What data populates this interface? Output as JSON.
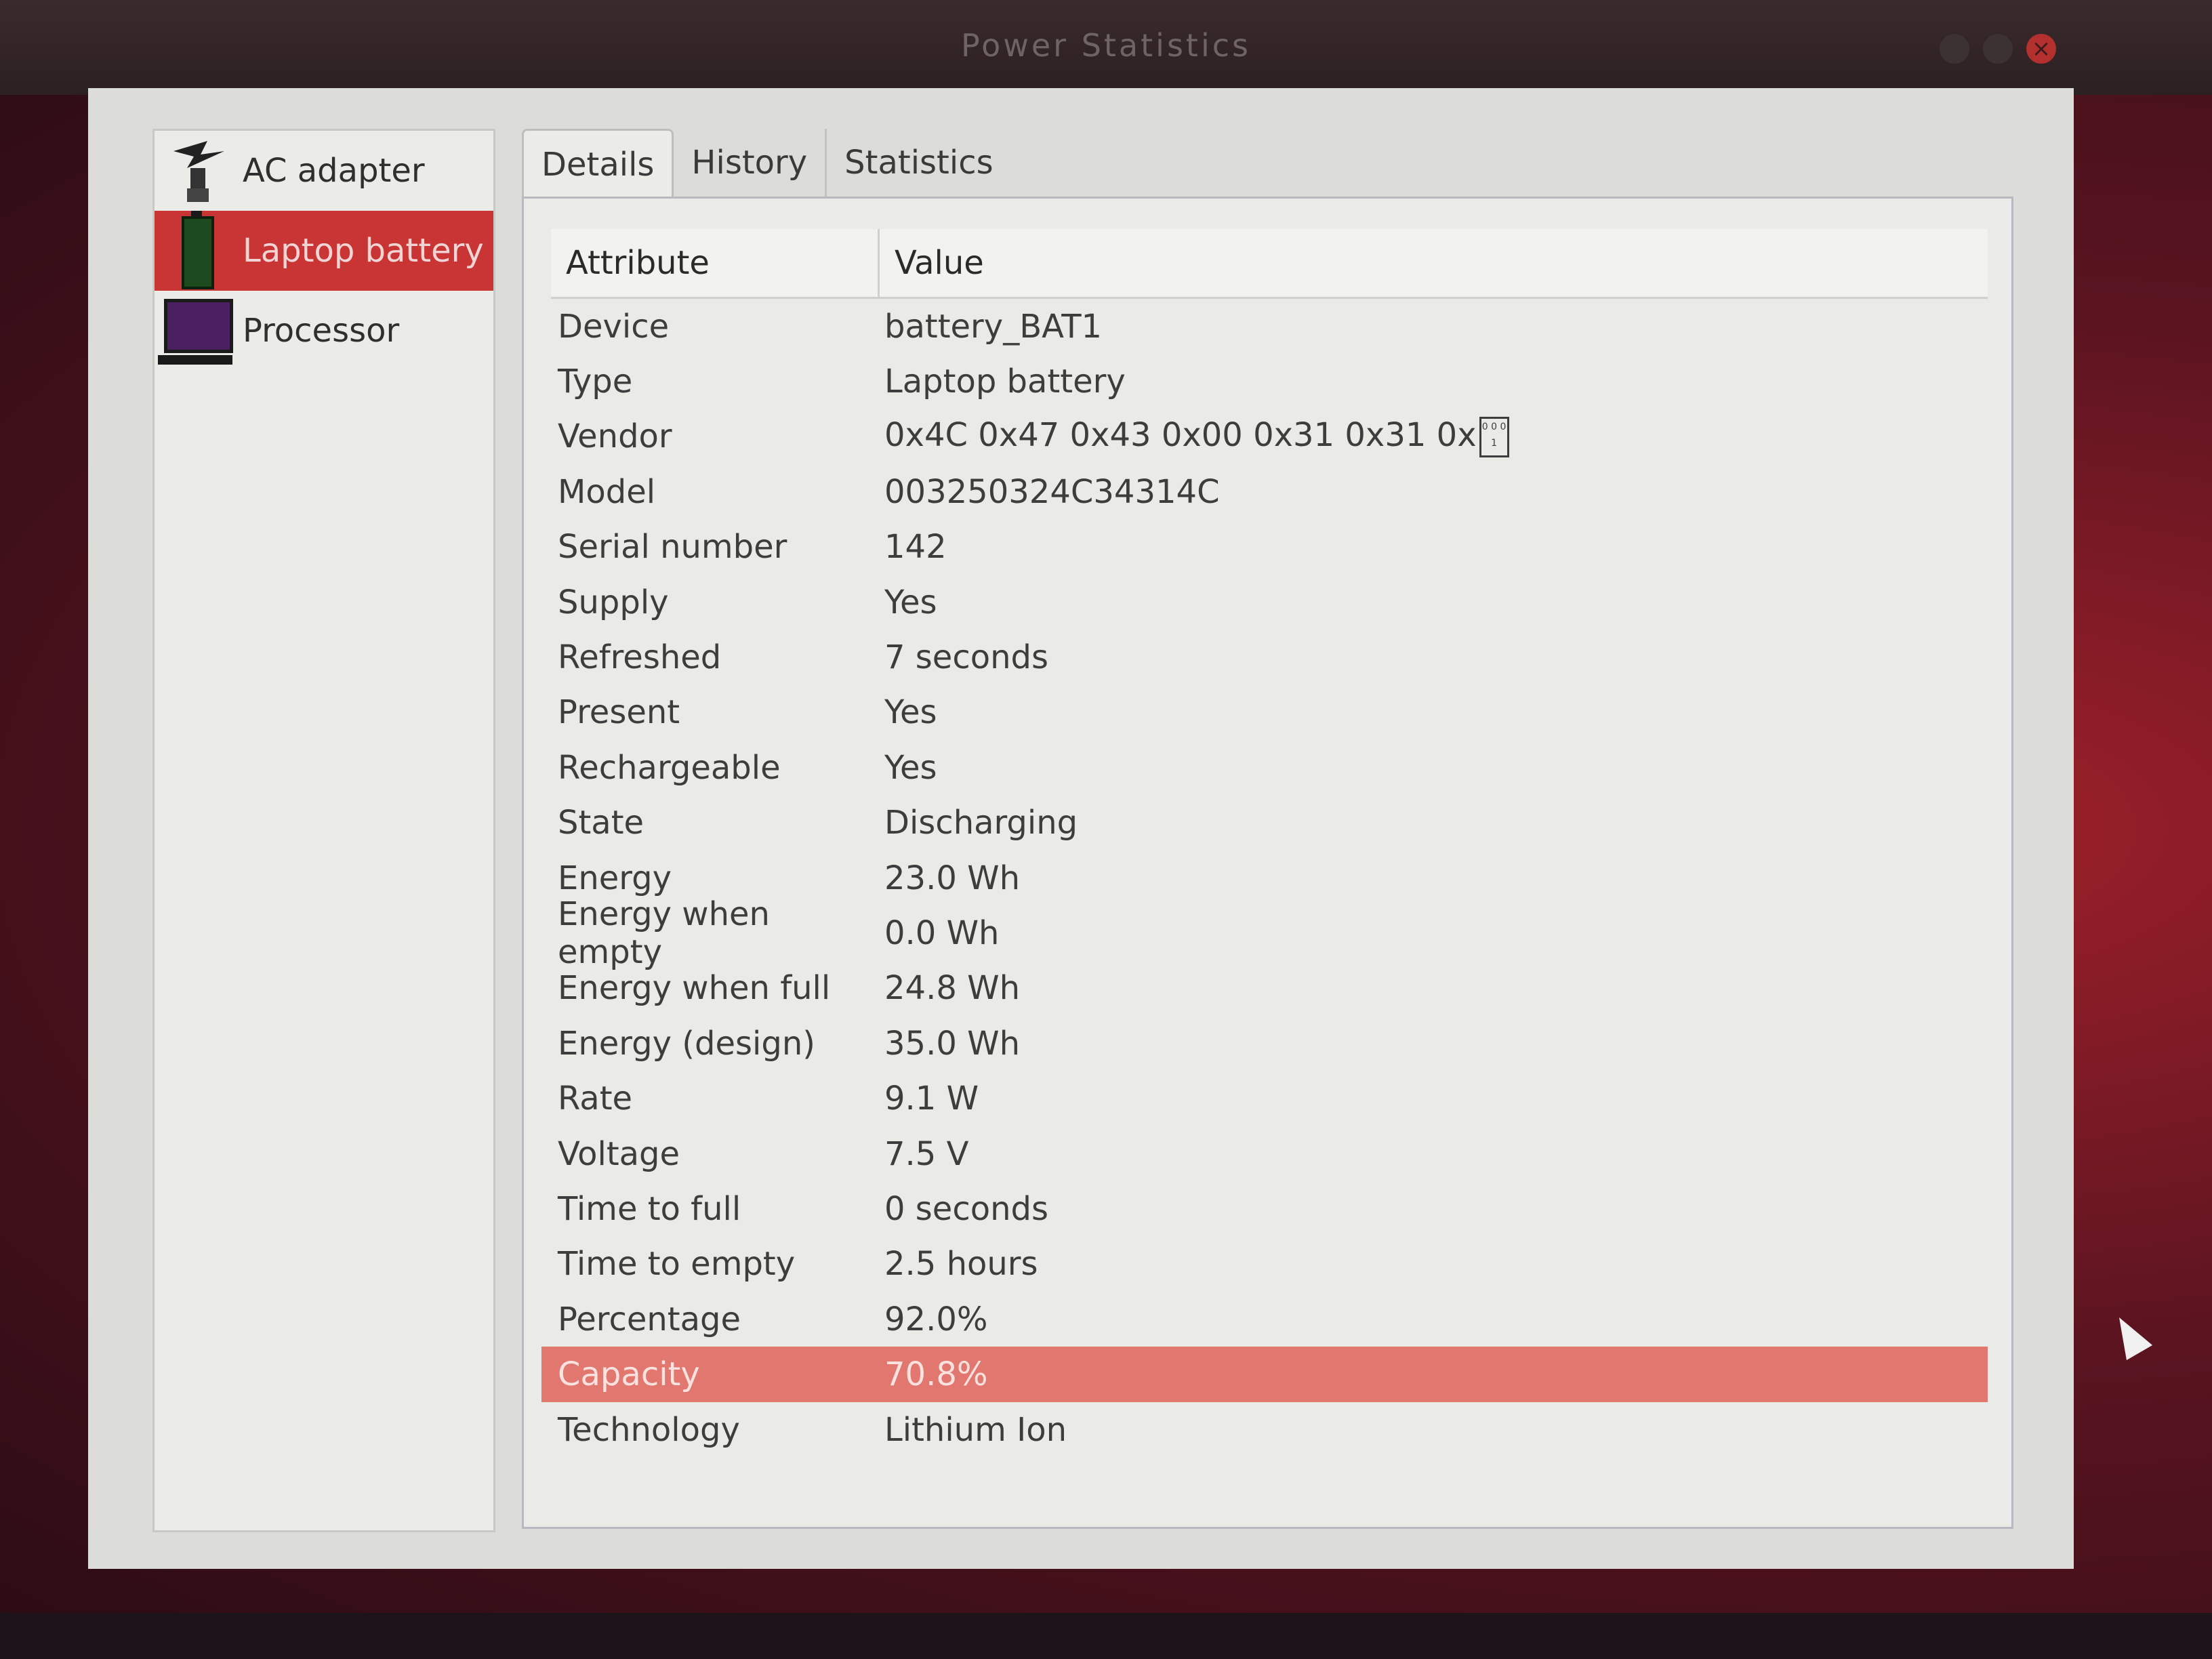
{
  "window": {
    "title": "Power Statistics"
  },
  "sidebar": {
    "items": [
      {
        "label": "AC adapter",
        "icon": "ac-adapter-icon"
      },
      {
        "label": "Laptop battery",
        "icon": "battery-icon",
        "selected": true
      },
      {
        "label": "Processor",
        "icon": "processor-icon"
      }
    ]
  },
  "tabs": [
    {
      "label": "Details",
      "active": true
    },
    {
      "label": "History"
    },
    {
      "label": "Statistics"
    }
  ],
  "table": {
    "headers": {
      "attribute": "Attribute",
      "value": "Value"
    },
    "rows": [
      {
        "attribute": "Device",
        "value": "battery_BAT1"
      },
      {
        "attribute": "Type",
        "value": "Laptop battery"
      },
      {
        "attribute": "Vendor",
        "value": "0x4C 0x47 0x43 0x00 0x31 0x31 0x"
      },
      {
        "attribute": "Model",
        "value": "003250324C34314C"
      },
      {
        "attribute": "Serial number",
        "value": "142"
      },
      {
        "attribute": "Supply",
        "value": "Yes"
      },
      {
        "attribute": "Refreshed",
        "value": "7 seconds"
      },
      {
        "attribute": "Present",
        "value": "Yes"
      },
      {
        "attribute": "Rechargeable",
        "value": "Yes"
      },
      {
        "attribute": "State",
        "value": "Discharging"
      },
      {
        "attribute": "Energy",
        "value": "23.0 Wh"
      },
      {
        "attribute": "Energy when empty",
        "value": "0.0 Wh"
      },
      {
        "attribute": "Energy when full",
        "value": "24.8 Wh"
      },
      {
        "attribute": "Energy (design)",
        "value": "35.0 Wh"
      },
      {
        "attribute": "Rate",
        "value": "9.1 W"
      },
      {
        "attribute": "Voltage",
        "value": "7.5 V"
      },
      {
        "attribute": "Time to full",
        "value": "0 seconds"
      },
      {
        "attribute": "Time to empty",
        "value": "2.5 hours"
      },
      {
        "attribute": "Percentage",
        "value": "92.0%"
      },
      {
        "attribute": "Capacity",
        "value": "70.8%",
        "selected": true
      },
      {
        "attribute": "Technology",
        "value": "Lithium Ion"
      }
    ],
    "vendor_glyph": "0 0 0 1"
  },
  "colors": {
    "selection": "#c93434",
    "row_selection": "#e2776f"
  }
}
